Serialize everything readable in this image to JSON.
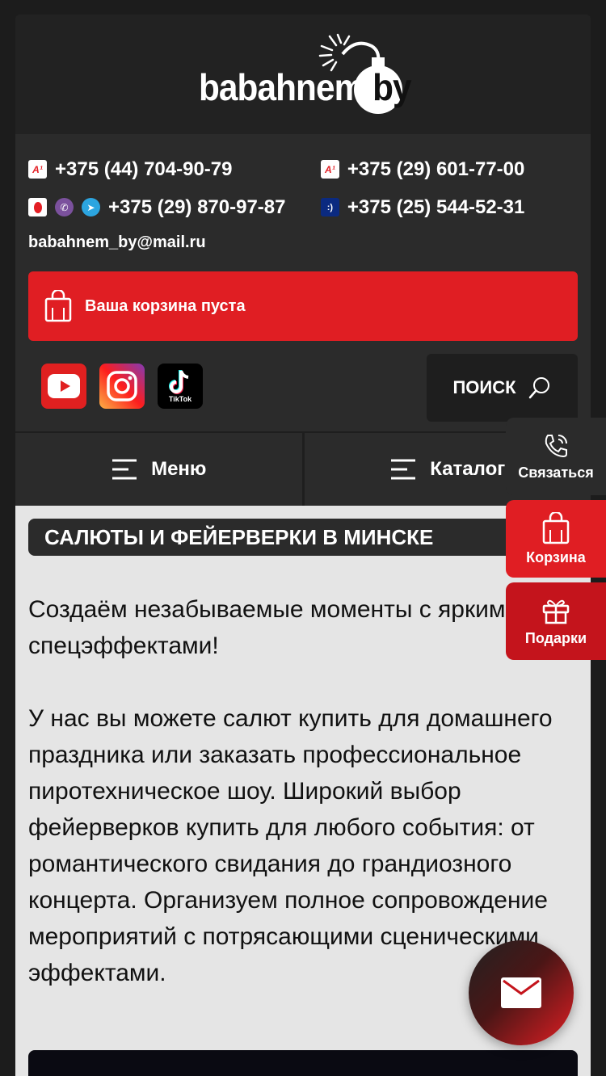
{
  "logo": {
    "brand": "babahnem.",
    "suffix": "by"
  },
  "contacts": {
    "phones": [
      {
        "operator": "a1-icon",
        "number": "+375 (44) 704-90-79"
      },
      {
        "operator": "a1-icon",
        "number": "+375 (29) 601-77-00"
      },
      {
        "operator": "mts-viber-telegram-icons",
        "number": "+375 (29) 870-97-87"
      },
      {
        "operator": "life-icon",
        "number": "+375 (25) 544-52-31"
      }
    ],
    "email": "babahnem_by@mail.ru"
  },
  "cart": {
    "label": "Ваша корзина пуста"
  },
  "social": {
    "youtube": "youtube-icon",
    "instagram": "instagram-icon",
    "tiktok": "tiktok-icon",
    "tiktok_label": "TikTok"
  },
  "search": {
    "label": "ПОИСК"
  },
  "nav": {
    "menu_label": "Меню",
    "catalog_label": "Каталог"
  },
  "side": {
    "contact_label": "Связаться",
    "cart_label": "Корзина",
    "gifts_label": "Подарки"
  },
  "content": {
    "title": "САЛЮТЫ И ФЕЙЕРВЕРКИ В МИНСКЕ",
    "paragraph1": "Создаём незабываемые моменты с яркими спецэффектами!",
    "paragraph2": "У нас вы можете салют купить для домашнего праздника или заказать профессиональное пиротехническое шоу. Широкий выбор фейерверков купить для любого события: от романтического свидания до грандиозного концерта. Организуем полное сопровождение мероприятий с потрясающими сценическими эффектами."
  },
  "colors": {
    "accent": "#e01e23",
    "dark": "#2b2b2b",
    "content_bg": "#e5e5e5"
  }
}
